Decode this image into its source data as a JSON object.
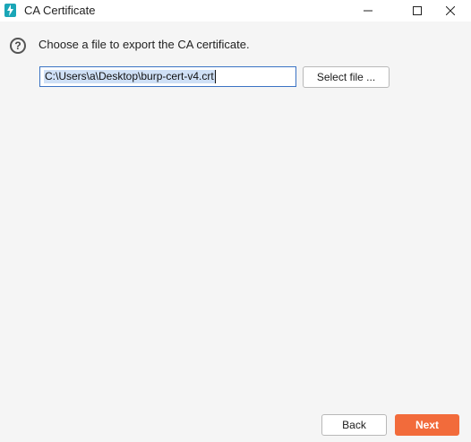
{
  "window": {
    "title": "CA Certificate",
    "icon": "burp-app-icon",
    "controls": [
      "minimize-icon",
      "maximize-icon",
      "close-icon"
    ]
  },
  "dialog": {
    "prompt": "Choose a file to export the CA certificate.",
    "path_value": "C:\\Users\\a\\Desktop\\burp-cert-v4.crt",
    "select_file_label": "Select file ...",
    "help_icon": "question-circle-icon"
  },
  "footer": {
    "back_label": "Back",
    "next_label": "Next"
  },
  "colors": {
    "accent": "#f26b3b",
    "input_border": "#3b73c4",
    "selection": "#cfe0f6",
    "app_icon": "#1aa6b7"
  }
}
